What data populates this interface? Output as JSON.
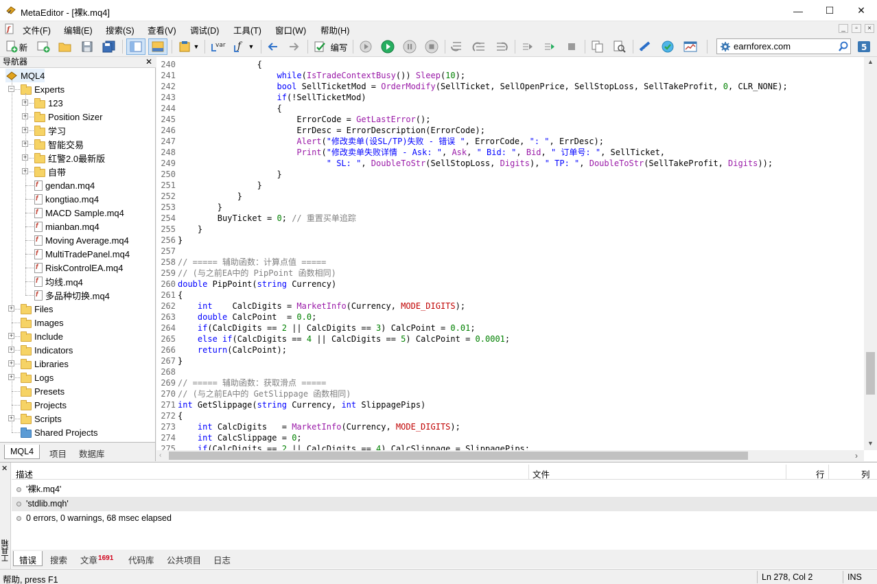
{
  "window": {
    "title": "MetaEditor - [裸k.mq4]",
    "minimize": "—",
    "maximize": "☐",
    "close": "✕"
  },
  "menu": [
    "文件(F)",
    "编辑(E)",
    "搜索(S)",
    "查看(V)",
    "调试(D)",
    "工具(T)",
    "窗口(W)",
    "帮助(H)"
  ],
  "toolbar": {
    "new_label": "新",
    "compile_label": "编写",
    "search_value": "earnforex.com"
  },
  "navigator": {
    "title": "导航器",
    "root": "MQL4",
    "nodes": [
      {
        "label": "Experts",
        "kind": "folder",
        "level": 1,
        "expander": "minus"
      },
      {
        "label": "123",
        "kind": "folder",
        "level": 2,
        "expander": "plus"
      },
      {
        "label": "Position Sizer",
        "kind": "folder",
        "level": 2,
        "expander": "plus"
      },
      {
        "label": "学习",
        "kind": "folder",
        "level": 2,
        "expander": "plus"
      },
      {
        "label": "智能交易",
        "kind": "folder",
        "level": 2,
        "expander": "plus"
      },
      {
        "label": "红警2.0最新版",
        "kind": "folder",
        "level": 2,
        "expander": "plus"
      },
      {
        "label": "自带",
        "kind": "folder",
        "level": 2,
        "expander": "plus"
      },
      {
        "label": "gendan.mq4",
        "kind": "file",
        "level": 2
      },
      {
        "label": "kongtiao.mq4",
        "kind": "file",
        "level": 2
      },
      {
        "label": "MACD Sample.mq4",
        "kind": "file",
        "level": 2
      },
      {
        "label": "mianban.mq4",
        "kind": "file",
        "level": 2
      },
      {
        "label": "Moving Average.mq4",
        "kind": "file",
        "level": 2
      },
      {
        "label": "MultiTradePanel.mq4",
        "kind": "file",
        "level": 2
      },
      {
        "label": "RiskControlEA.mq4",
        "kind": "file",
        "level": 2
      },
      {
        "label": "均线.mq4",
        "kind": "file",
        "level": 2
      },
      {
        "label": "多品种切换.mq4",
        "kind": "file",
        "level": 2
      },
      {
        "label": "Files",
        "kind": "folder",
        "level": 1,
        "expander": "plus"
      },
      {
        "label": "Images",
        "kind": "folder",
        "level": 1
      },
      {
        "label": "Include",
        "kind": "folder",
        "level": 1,
        "expander": "plus"
      },
      {
        "label": "Indicators",
        "kind": "folder",
        "level": 1,
        "expander": "plus"
      },
      {
        "label": "Libraries",
        "kind": "folder",
        "level": 1,
        "expander": "plus"
      },
      {
        "label": "Logs",
        "kind": "folder",
        "level": 1,
        "expander": "plus"
      },
      {
        "label": "Presets",
        "kind": "folder",
        "level": 1
      },
      {
        "label": "Projects",
        "kind": "folder",
        "level": 1
      },
      {
        "label": "Scripts",
        "kind": "folder",
        "level": 1,
        "expander": "plus"
      },
      {
        "label": "Shared Projects",
        "kind": "folder-blue",
        "level": 1
      }
    ],
    "tabs": [
      "MQL4",
      "项目",
      "数据库"
    ]
  },
  "editor": {
    "lines": [
      {
        "n": "240",
        "t": [
          [
            "                {",
            ""
          ]
        ]
      },
      {
        "n": "241",
        "t": [
          [
            "                    ",
            ""
          ],
          [
            "while",
            "k"
          ],
          [
            "(",
            ""
          ],
          [
            "IsTradeContextBusy",
            "f"
          ],
          [
            "()) ",
            ""
          ],
          [
            "Sleep",
            "f"
          ],
          [
            "(",
            ""
          ],
          [
            "10",
            "n"
          ],
          [
            ");",
            ""
          ]
        ]
      },
      {
        "n": "242",
        "t": [
          [
            "                    ",
            ""
          ],
          [
            "bool",
            "k"
          ],
          [
            " SellTicketMod = ",
            ""
          ],
          [
            "OrderModify",
            "f"
          ],
          [
            "(SellTicket, SellOpenPrice, SellStopLoss, SellTakeProfit, ",
            ""
          ],
          [
            "0",
            "n"
          ],
          [
            ", CLR_NONE);",
            ""
          ]
        ]
      },
      {
        "n": "243",
        "t": [
          [
            "                    ",
            ""
          ],
          [
            "if",
            "k"
          ],
          [
            "(!SellTicketMod)",
            ""
          ]
        ]
      },
      {
        "n": "244",
        "t": [
          [
            "                    {",
            ""
          ]
        ]
      },
      {
        "n": "245",
        "t": [
          [
            "                        ErrorCode = ",
            ""
          ],
          [
            "GetLastError",
            "f"
          ],
          [
            "();",
            ""
          ]
        ]
      },
      {
        "n": "246",
        "t": [
          [
            "                        ErrDesc = ErrorDescription(ErrorCode);",
            ""
          ]
        ]
      },
      {
        "n": "247",
        "t": [
          [
            "                        ",
            ""
          ],
          [
            "Alert",
            "f"
          ],
          [
            "(",
            ""
          ],
          [
            "\"修改卖单(设SL/TP)失败 - 错误 \"",
            "s"
          ],
          [
            ", ErrorCode, ",
            ""
          ],
          [
            "\": \"",
            "s"
          ],
          [
            ", ErrDesc);",
            ""
          ]
        ]
      },
      {
        "n": "248",
        "t": [
          [
            "                        ",
            ""
          ],
          [
            "Print",
            "f"
          ],
          [
            "(",
            ""
          ],
          [
            "\"修改卖单失败详情 - Ask: \"",
            "s"
          ],
          [
            ", ",
            ""
          ],
          [
            "Ask",
            "f"
          ],
          [
            ", ",
            ""
          ],
          [
            "\" Bid: \"",
            "s"
          ],
          [
            ", ",
            ""
          ],
          [
            "Bid",
            "f"
          ],
          [
            ", ",
            ""
          ],
          [
            "\" 订单号: \"",
            "s"
          ],
          [
            ", SellTicket,",
            ""
          ]
        ]
      },
      {
        "n": "249",
        "t": [
          [
            "                              ",
            ""
          ],
          [
            "\" SL: \"",
            "s"
          ],
          [
            ", ",
            ""
          ],
          [
            "DoubleToStr",
            "f"
          ],
          [
            "(SellStopLoss, ",
            ""
          ],
          [
            "Digits",
            "f"
          ],
          [
            "), ",
            ""
          ],
          [
            "\" TP: \"",
            "s"
          ],
          [
            ", ",
            ""
          ],
          [
            "DoubleToStr",
            "f"
          ],
          [
            "(SellTakeProfit, ",
            ""
          ],
          [
            "Digits",
            "f"
          ],
          [
            "));",
            ""
          ]
        ]
      },
      {
        "n": "250",
        "t": [
          [
            "                    }",
            ""
          ]
        ]
      },
      {
        "n": "251",
        "t": [
          [
            "                }",
            ""
          ]
        ]
      },
      {
        "n": "252",
        "t": [
          [
            "            }",
            ""
          ]
        ]
      },
      {
        "n": "253",
        "t": [
          [
            "        }",
            ""
          ]
        ]
      },
      {
        "n": "254",
        "t": [
          [
            "        BuyTicket = ",
            ""
          ],
          [
            "0",
            "n"
          ],
          [
            "; ",
            ""
          ],
          [
            "// 重置买单追踪",
            "c"
          ]
        ]
      },
      {
        "n": "255",
        "t": [
          [
            "    }",
            ""
          ]
        ]
      },
      {
        "n": "256",
        "t": [
          [
            "}",
            ""
          ]
        ]
      },
      {
        "n": "257",
        "t": [
          [
            "",
            ""
          ]
        ]
      },
      {
        "n": "258",
        "t": [
          [
            "// ===== 辅助函数：计算点值 =====",
            "c"
          ]
        ]
      },
      {
        "n": "259",
        "t": [
          [
            "// (与之前EA中的 PipPoint 函数相同)",
            "c"
          ]
        ]
      },
      {
        "n": "260",
        "t": [
          [
            "double",
            "k"
          ],
          [
            " PipPoint(",
            ""
          ],
          [
            "string",
            "k"
          ],
          [
            " Currency)",
            ""
          ]
        ]
      },
      {
        "n": "261",
        "t": [
          [
            "{",
            ""
          ]
        ]
      },
      {
        "n": "262",
        "t": [
          [
            "    ",
            ""
          ],
          [
            "int",
            "k"
          ],
          [
            "    CalcDigits = ",
            ""
          ],
          [
            "MarketInfo",
            "f"
          ],
          [
            "(Currency, ",
            ""
          ],
          [
            "MODE_DIGITS",
            "m"
          ],
          [
            ");",
            ""
          ]
        ]
      },
      {
        "n": "263",
        "t": [
          [
            "    ",
            ""
          ],
          [
            "double",
            "k"
          ],
          [
            " CalcPoint  = ",
            ""
          ],
          [
            "0.0",
            "n"
          ],
          [
            ";",
            ""
          ]
        ]
      },
      {
        "n": "264",
        "t": [
          [
            "    ",
            ""
          ],
          [
            "if",
            "k"
          ],
          [
            "(CalcDigits == ",
            ""
          ],
          [
            "2",
            "n"
          ],
          [
            " || CalcDigits == ",
            ""
          ],
          [
            "3",
            "n"
          ],
          [
            ") CalcPoint = ",
            ""
          ],
          [
            "0.01",
            "n"
          ],
          [
            ";",
            ""
          ]
        ]
      },
      {
        "n": "265",
        "t": [
          [
            "    ",
            ""
          ],
          [
            "else",
            "k"
          ],
          [
            " ",
            ""
          ],
          [
            "if",
            "k"
          ],
          [
            "(CalcDigits == ",
            ""
          ],
          [
            "4",
            "n"
          ],
          [
            " || CalcDigits == ",
            ""
          ],
          [
            "5",
            "n"
          ],
          [
            ") CalcPoint = ",
            ""
          ],
          [
            "0.0001",
            "n"
          ],
          [
            ";",
            ""
          ]
        ]
      },
      {
        "n": "266",
        "t": [
          [
            "    ",
            ""
          ],
          [
            "return",
            "k"
          ],
          [
            "(CalcPoint);",
            ""
          ]
        ]
      },
      {
        "n": "267",
        "t": [
          [
            "}",
            ""
          ]
        ]
      },
      {
        "n": "268",
        "t": [
          [
            "",
            ""
          ]
        ]
      },
      {
        "n": "269",
        "t": [
          [
            "// ===== 辅助函数：获取滑点 =====",
            "c"
          ]
        ]
      },
      {
        "n": "270",
        "t": [
          [
            "// (与之前EA中的 GetSlippage 函数相同)",
            "c"
          ]
        ]
      },
      {
        "n": "271",
        "t": [
          [
            "int",
            "k"
          ],
          [
            " GetSlippage(",
            ""
          ],
          [
            "string",
            "k"
          ],
          [
            " Currency, ",
            ""
          ],
          [
            "int",
            "k"
          ],
          [
            " SlippagePips)",
            ""
          ]
        ]
      },
      {
        "n": "272",
        "t": [
          [
            "{",
            ""
          ]
        ]
      },
      {
        "n": "273",
        "t": [
          [
            "    ",
            ""
          ],
          [
            "int",
            "k"
          ],
          [
            " CalcDigits   = ",
            ""
          ],
          [
            "MarketInfo",
            "f"
          ],
          [
            "(Currency, ",
            ""
          ],
          [
            "MODE_DIGITS",
            "m"
          ],
          [
            ");",
            ""
          ]
        ]
      },
      {
        "n": "274",
        "t": [
          [
            "    ",
            ""
          ],
          [
            "int",
            "k"
          ],
          [
            " CalcSlippage = ",
            ""
          ],
          [
            "0",
            "n"
          ],
          [
            ";",
            ""
          ]
        ]
      },
      {
        "n": "275",
        "t": [
          [
            "    ",
            ""
          ],
          [
            "if",
            "k"
          ],
          [
            "(CalcDigits == ",
            ""
          ],
          [
            "2",
            "n"
          ],
          [
            " || CalcDigits == ",
            ""
          ],
          [
            "4",
            "n"
          ],
          [
            ") CalcSlippage = SlippagePips;",
            ""
          ]
        ]
      }
    ]
  },
  "toolbox": {
    "side_label": "工具箱",
    "columns": [
      "描述",
      "文件",
      "行",
      "列"
    ],
    "rows": [
      "'裸k.mq4'",
      "'stdlib.mqh'",
      "0 errors, 0 warnings, 68 msec elapsed"
    ],
    "tabs": [
      "错误",
      "搜索",
      "文章",
      "代码库",
      "公共项目",
      "日志"
    ],
    "articles_badge": "1691"
  },
  "statusbar": {
    "help": "帮助, press F1",
    "position": "Ln 278, Col 2",
    "mode": "INS"
  },
  "colors": {
    "keyword": "#0000ff",
    "function": "#9a1aa8",
    "comment": "#808080",
    "number": "#008000",
    "constant": "#c00000"
  }
}
